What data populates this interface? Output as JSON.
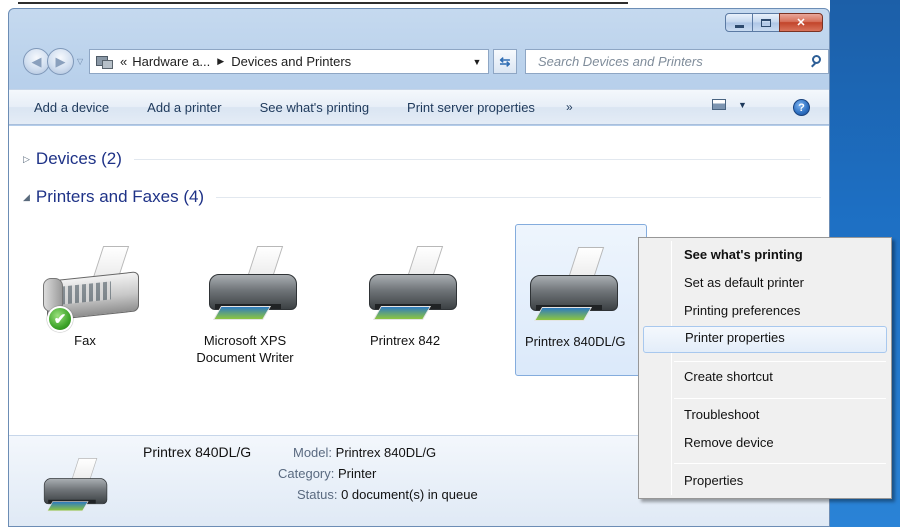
{
  "window": {
    "min_icon": "minimize-icon",
    "max_icon": "maximize-icon",
    "close_icon": "close-icon",
    "close_glyph": "✕"
  },
  "nav": {
    "back_icon": "back-arrow-icon",
    "forward_icon": "forward-arrow-icon",
    "back_glyph": "◀",
    "forward_glyph": "▶",
    "history_glyph": "▽"
  },
  "address": {
    "overflow": "«",
    "segments": [
      "Hardware a...",
      "Devices and Printers"
    ],
    "separator": "▶",
    "dropdown_glyph": "▼"
  },
  "refresh": {
    "glyph": "⇆"
  },
  "search": {
    "placeholder": "Search Devices and Printers"
  },
  "toolbar": {
    "items": [
      "Add a device",
      "Add a printer",
      "See what's printing",
      "Print server properties"
    ],
    "more": "»",
    "view_drop": "▼",
    "help": "?"
  },
  "groups": {
    "devices": {
      "label": "Devices (2)",
      "glyph": "▷"
    },
    "printers": {
      "label": "Printers and Faxes (4)",
      "glyph": "◢"
    }
  },
  "printers": [
    {
      "name": "Fax",
      "default": true
    },
    {
      "name": "Microsoft XPS Document Writer",
      "default": false
    },
    {
      "name": "Printrex 842",
      "default": false
    },
    {
      "name": "Printrex 840DL/G",
      "default": false,
      "selected": true
    }
  ],
  "check_glyph": "✔",
  "details": {
    "name": "Printrex 840DL/G",
    "model_label": "Model:",
    "model": "Printrex 840DL/G",
    "category_label": "Category:",
    "category": "Printer",
    "status_label": "Status:",
    "status": "0 document(s) in queue"
  },
  "context_menu": {
    "items": [
      "See what's printing",
      "Set as default printer",
      "Printing preferences",
      "Printer properties",
      "Create shortcut",
      "Troubleshoot",
      "Remove device",
      "Properties"
    ],
    "hovered": "Printer properties"
  },
  "colors": {
    "group_heading": "#1e3287",
    "toolbar_text": "#1e395b",
    "close_button": "#c2442a",
    "selection_border": "#84acdd"
  }
}
